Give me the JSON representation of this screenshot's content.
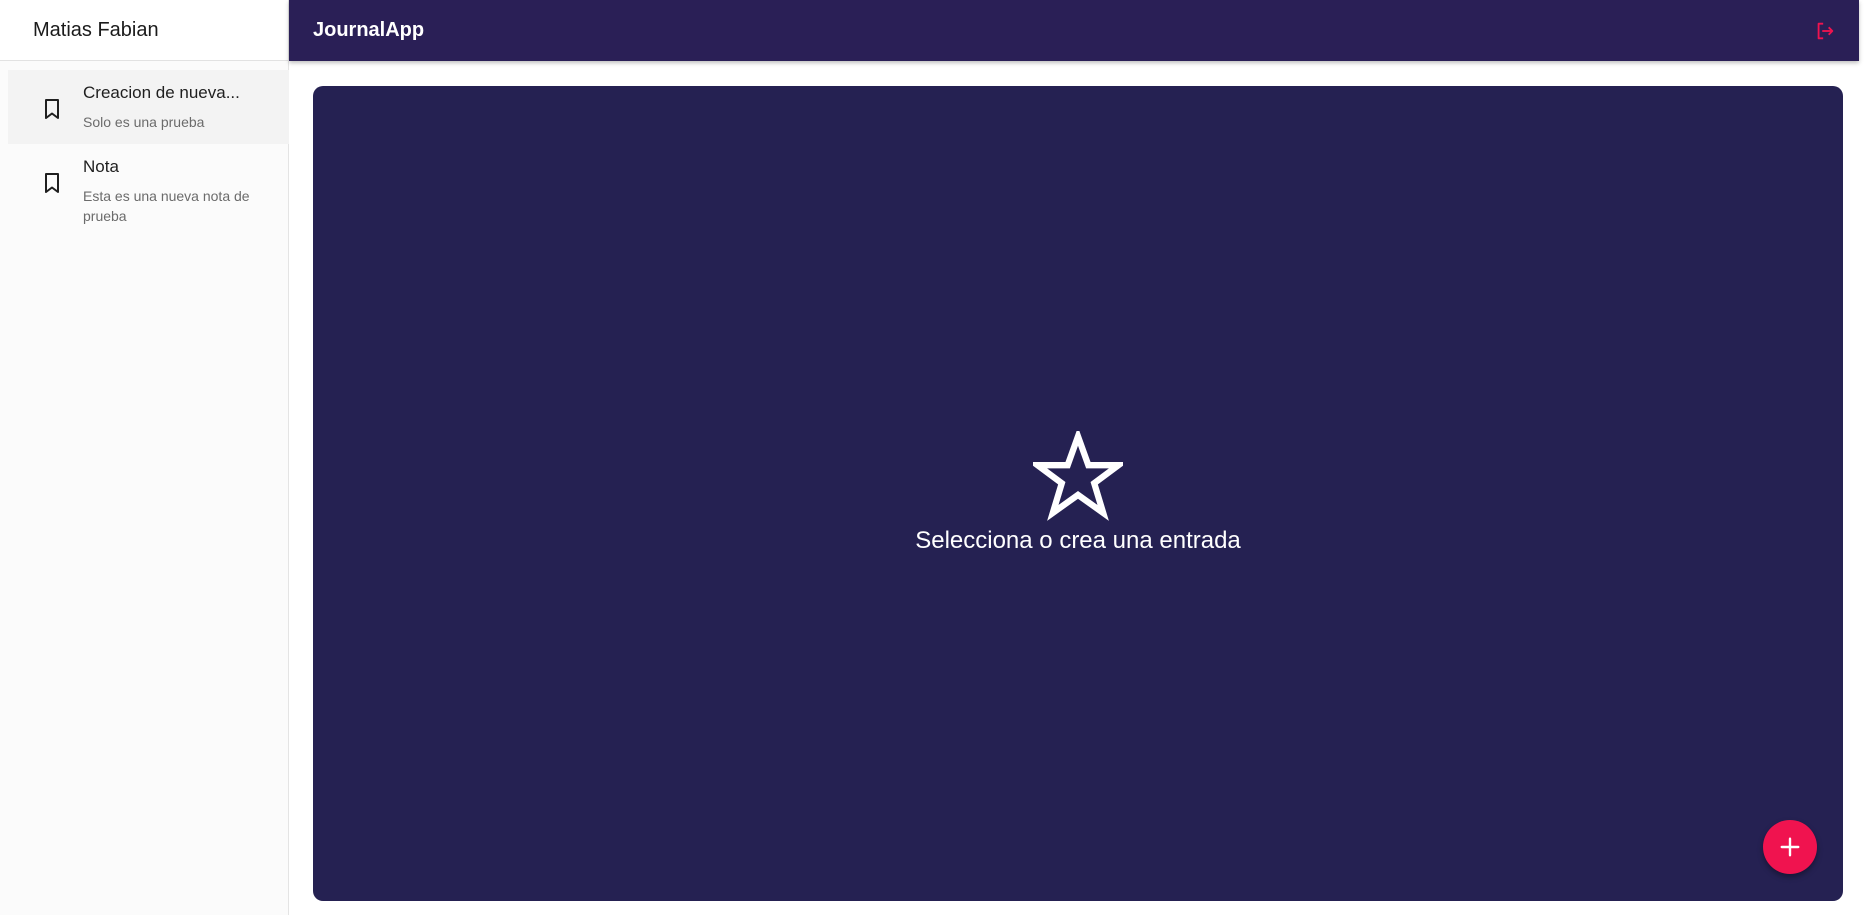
{
  "sidebar": {
    "user_name": "Matias Fabian",
    "notes": [
      {
        "title": "Creacion de nueva...",
        "body": "Solo es una prueba",
        "icon": "bookmark-icon"
      },
      {
        "title": "Nota",
        "body": "Esta es una nueva nota de prueba",
        "icon": "bookmark-icon"
      }
    ]
  },
  "header": {
    "title": "JournalApp",
    "logout_icon": "logout-icon"
  },
  "main": {
    "empty_icon": "star-outline-icon",
    "empty_message": "Selecciona o crea una entrada",
    "fab_icon": "plus-icon"
  },
  "colors": {
    "primary_dark": "#2a1f56",
    "panel_bg": "#252152",
    "accent": "#f0134f"
  }
}
